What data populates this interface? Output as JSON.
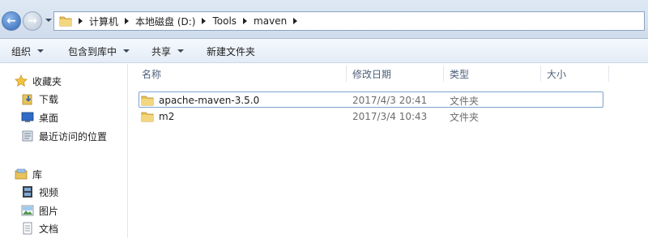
{
  "address_bar": {
    "breadcrumbs": [
      "计算机",
      "本地磁盘 (D:)",
      "Tools",
      "maven"
    ]
  },
  "toolbar": {
    "organize": "组织",
    "include_in_library": "包含到库中",
    "share": "共享",
    "new_folder": "新建文件夹"
  },
  "nav": {
    "favorites": {
      "label": "收藏夹",
      "items": [
        {
          "label": "下载",
          "icon": "download-folder-icon"
        },
        {
          "label": "桌面",
          "icon": "desktop-icon"
        },
        {
          "label": "最近访问的位置",
          "icon": "recent-places-icon"
        }
      ]
    },
    "libraries": {
      "label": "库",
      "items": [
        {
          "label": "视频",
          "icon": "video-library-icon"
        },
        {
          "label": "图片",
          "icon": "pictures-library-icon"
        },
        {
          "label": "文档",
          "icon": "documents-library-icon"
        }
      ]
    }
  },
  "columns": {
    "name": "名称",
    "modified": "修改日期",
    "type": "类型",
    "size": "大小"
  },
  "files": [
    {
      "name": "apache-maven-3.5.0",
      "modified": "2017/4/3 20:41",
      "type": "文件夹",
      "size": "",
      "selected": true
    },
    {
      "name": "m2",
      "modified": "2017/3/4 10:43",
      "type": "文件夹",
      "size": "",
      "selected": false
    }
  ],
  "colors": {
    "folder": "#e8c25a",
    "selection_border": "#7da2ce",
    "header_text": "#4c607a"
  }
}
